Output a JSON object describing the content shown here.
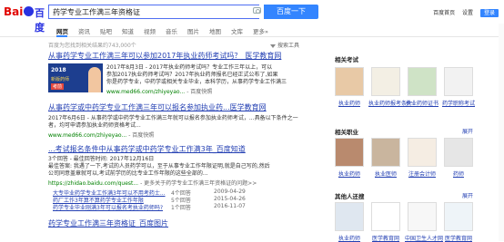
{
  "logo": {
    "left": "Bai",
    "right": "百度"
  },
  "search": {
    "value": "药学专业工作满三年资格证",
    "button": "百度一下"
  },
  "top_links": {
    "settings": "百度首页",
    "prefs": "设置",
    "login": "登录"
  },
  "tabs": [
    "网页",
    "资讯",
    "贴吧",
    "知道",
    "视频",
    "音乐",
    "图片",
    "地图",
    "文库",
    "更多»"
  ],
  "result_count": "百度为您找到相关结果约743,000个",
  "search_tools": "搜索工具",
  "results": [
    {
      "title": "从事药学专业工作满三年可以参加2017年执业药师考试吗？_医学教育网",
      "snippet1": "2017年8月3日 - 2017年执业药师考试吗？专业工作三年以上，可以",
      "snippet2": "参加2017执业药师考试吗？2017年执业药师报名已经正式公布了,如果",
      "snippet3": "你是药学专业，中药学或相关专业毕业，本科学历，从事药学专业工作满三",
      "url": "www.med66.com/zhiyeyao...",
      "snapshot": "- 百度快照"
    },
    {
      "title": "从事药学或中药学专业工作满三年可以报名参加执业药...医学教育网",
      "snippet1": "2017年6月6日 - 从事药学或中药学专业工作满三年就可以报名参加执业药师考试，...具备以下条件之一",
      "snippet2": "者，均可申请参加执业药师资格考试...",
      "url": "www.med66.com/zhiyeyao...",
      "snapshot": "- 百度快照"
    },
    {
      "title": "...考试报名条件中从事药学或中药学专业工作满3年_百度知道",
      "snippet1": "3个回答 - 最佳回答时间: 2017年12月16日",
      "snippet2": "最佳答案: 我遇了一下,考试的人员药学可以，至于从事专业工作年限证明,就是自己写的,然后",
      "snippet3": "公司同意盖章就可以,考试前学历的比专业工作年限的这些全部的...",
      "url": "https://zhidao.baidu.com/quest...",
      "snapshot": "- 更多关于药学专业工作满三年资格证的问题>>"
    }
  ],
  "qa": [
    {
      "q": "大专毕业药学专业工作满3年可以不用考药士...",
      "n": "4个回答",
      "d": "2009-04-29"
    },
    {
      "q": "药厂工作3年算不算药学专业工作年限",
      "n": "5个回答",
      "d": "2015-04-26"
    },
    {
      "q": "药学专业毕业刚满3年可以报名考执业药师吗?",
      "n": "1个回答",
      "d": "2016-11-07"
    }
  ],
  "result4_title": "药学专业工作满三年资格证_百度图片",
  "sidebar": {
    "section1_title": "相关考试",
    "section1": [
      "执业药师",
      "执业药师报考条件",
      "执业药师证书",
      "药学职称考试"
    ],
    "section2_title": "相关职业",
    "section2_expand": "展开",
    "section2": [
      "执业药师",
      "执业医师",
      "注册会计师",
      "药师"
    ],
    "section3_title": "其他人还搜",
    "section3_expand": "展开",
    "section3": [
      "执业药师",
      "医学教育网",
      "中国卫生人才网",
      "医学教育网"
    ]
  },
  "colors": {
    "accent": "#3385ff",
    "link": "#2440b3",
    "highlight": "#c00",
    "url": "#008000"
  }
}
